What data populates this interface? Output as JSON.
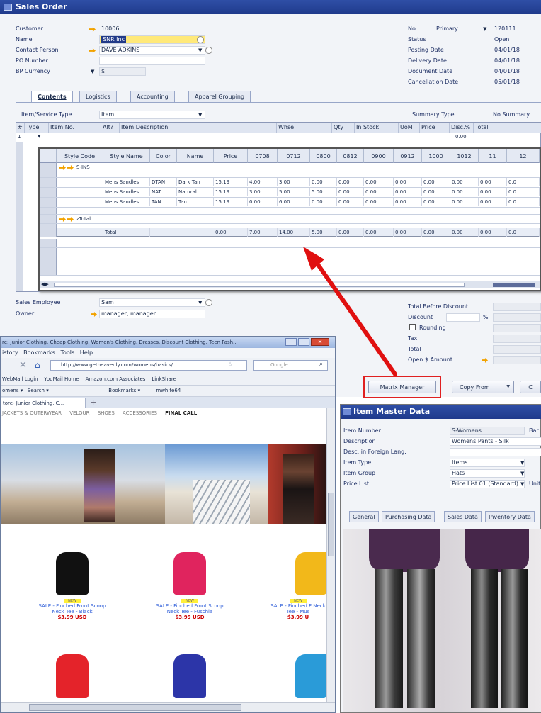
{
  "sales_order": {
    "title": "Sales Order",
    "left_fields": [
      {
        "label": "Customer",
        "value": "10006"
      },
      {
        "label": "Name",
        "value": "SNR Inc"
      },
      {
        "label": "Contact Person",
        "value": "DAVE ADKINS"
      },
      {
        "label": "PO Number",
        "value": ""
      },
      {
        "label": "BP Currency",
        "value": "$"
      }
    ],
    "right_fields": [
      {
        "label": "No.",
        "value": "120111",
        "series": "Primary"
      },
      {
        "label": "Status",
        "value": "Open"
      },
      {
        "label": "Posting Date",
        "value": "04/01/18"
      },
      {
        "label": "Delivery Date",
        "value": "04/01/18"
      },
      {
        "label": "Document Date",
        "value": "04/01/18"
      },
      {
        "label": "Cancellation Date",
        "value": "05/01/18"
      }
    ],
    "tabs": [
      "Contents",
      "Logistics",
      "Accounting",
      "Apparel Grouping"
    ],
    "item_service_type_label": "Item/Service Type",
    "item_service_type_value": "Item",
    "summary_type_label": "Summary Type",
    "summary_type_value": "No Summary",
    "grid_headers": [
      "#",
      "Type",
      "Item No.",
      "Alt?",
      "Item Description",
      "Whse",
      "Qty",
      "In Stock",
      "UoM",
      "Price",
      "Disc.%",
      "Total"
    ],
    "grid_row1": {
      "num": "1",
      "disc": "0.00"
    },
    "matrix": {
      "headers": [
        "Style Code",
        "Style Name",
        "Color",
        "Name",
        "Price",
        "0708",
        "0712",
        "0800",
        "0812",
        "0900",
        "0912",
        "1000",
        "1012",
        "11",
        "12"
      ],
      "group_label": "S-INS",
      "rows": [
        [
          "Mens Sandles",
          "DTAN",
          "Dark Tan",
          "15.19",
          "4.00",
          "3.00",
          "0.00",
          "0.00",
          "0.00",
          "0.00",
          "0.00",
          "0.00",
          "0.00",
          "0.0"
        ],
        [
          "Mens Sandles",
          "NAT",
          "Natural",
          "15.19",
          "3.00",
          "5.00",
          "5.00",
          "0.00",
          "0.00",
          "0.00",
          "0.00",
          "0.00",
          "0.00",
          "0.0"
        ],
        [
          "Mens Sandles",
          "TAN",
          "Tan",
          "15.19",
          "0.00",
          "6.00",
          "0.00",
          "0.00",
          "0.00",
          "0.00",
          "0.00",
          "0.00",
          "0.00",
          "0.0"
        ]
      ],
      "subtotal_label": "zTotal",
      "total_label": "Total",
      "total_row": [
        "0.00",
        "7.00",
        "14.00",
        "5.00",
        "0.00",
        "0.00",
        "0.00",
        "0.00",
        "0.00",
        "0.00",
        "0.0"
      ]
    },
    "sales_employee_label": "Sales Employee",
    "sales_employee_value": "Sam",
    "owner_label": "Owner",
    "owner_value": "manager, manager",
    "totals": {
      "before_discount": "Total Before Discount",
      "discount": "Discount",
      "percent": "%",
      "rounding": "Rounding",
      "tax": "Tax",
      "total": "Total",
      "open_amount": "Open $ Amount"
    },
    "buttons": {
      "matrix_manager": "Matrix Manager",
      "copy_from": "Copy From",
      "third": "C"
    }
  },
  "browser": {
    "title": "re: Junior Clothing, Cheap Clothing, Women's Clothing, Dresses, Discount Clothing, Teen Fash...",
    "menu": [
      "istory",
      "Bookmarks",
      "Tools",
      "Help"
    ],
    "url": "http://www.getheavenly.com/womens/basics/",
    "search_placeholder": "Google",
    "bookmarks": [
      "WebMail Login",
      "YouMail Home",
      "Amazon.com Associates",
      "LinkShare"
    ],
    "toolbar_items": [
      "omens",
      "Search",
      "Bookmarks"
    ],
    "user": "mwhite64",
    "tab_label": "tore- Junior Clothing, C...",
    "categories": [
      "JACKETS & OUTERWEAR",
      "VELOUR",
      "SHOES",
      "ACCESSORIES",
      "FINAL CALL"
    ],
    "products": [
      {
        "badge": "NEW",
        "name": "SALE - Finched Front Scoop Neck Tee - Black",
        "price": "$3.99 USD"
      },
      {
        "badge": "NEW",
        "name": "SALE - Finched Front Scoop Neck Tee - Fuschia",
        "price": "$3.99 USD"
      },
      {
        "badge": "NEW",
        "name": "SALE - Finched F Neck Tee - Mus",
        "price": "$3.99 U"
      }
    ]
  },
  "item_master": {
    "title": "Item Master Data",
    "fields": [
      {
        "label": "Item Number",
        "value": "S-Womens"
      },
      {
        "label": "Description",
        "value": "Womens Pants - Silk"
      },
      {
        "label": "Desc. in Foreign Lang.",
        "value": ""
      },
      {
        "label": "Item Type",
        "value": "Items"
      },
      {
        "label": "Item Group",
        "value": "Hats"
      },
      {
        "label": "Price List",
        "value": "Price List 01 (Standard)"
      }
    ],
    "side_labels": [
      "Bar",
      "Unit"
    ],
    "tabs": [
      "General",
      "Purchasing Data",
      "Sales Data",
      "Inventory Data"
    ]
  },
  "colors": {
    "title_bar": "#2444a0",
    "highlight_box": "#e02020",
    "arrow": "#e01010",
    "selected_field": "#ffe97a"
  }
}
